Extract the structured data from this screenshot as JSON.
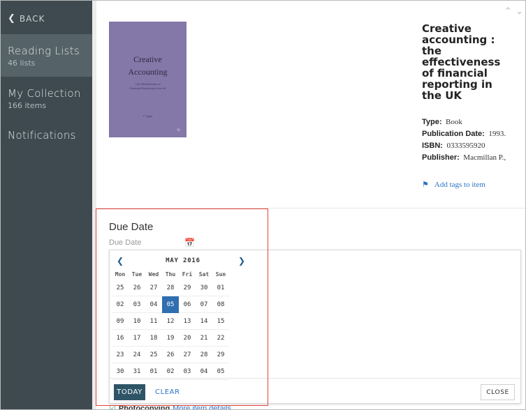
{
  "sidebar": {
    "back_label": "BACK",
    "items": [
      {
        "label": "Reading Lists",
        "sub": "46 lists"
      },
      {
        "label": "My Collection",
        "sub": "166 items"
      },
      {
        "label": "Notifications",
        "sub": ""
      }
    ]
  },
  "book": {
    "cover": {
      "title_line1": "Creative",
      "title_line2": "Accounting",
      "subtitle_line1": "The Effectiveness of",
      "subtitle_line2": "Financial Reporting in the UK",
      "author": "T Pijper"
    },
    "title": "Creative accounting : the effectiveness of financial reporting in the UK",
    "type_label": "Type:",
    "type_value": "Book",
    "date_label": "Publication Date:",
    "date_value": "1993.",
    "isbn_label": "ISBN:",
    "isbn_value": "0333595920",
    "publisher_label": "Publisher:",
    "publisher_value": "Macmillan P.,",
    "add_tags": "Add tags to item"
  },
  "due_date": {
    "title": "Due Date",
    "field_placeholder": "Due Date"
  },
  "calendar": {
    "month_label": "MAY 2016",
    "weekdays": [
      "Mon",
      "Tue",
      "Wed",
      "Thu",
      "Fri",
      "Sat",
      "Sun"
    ],
    "weeks": [
      [
        "25",
        "26",
        "27",
        "28",
        "29",
        "30",
        "01"
      ],
      [
        "02",
        "03",
        "04",
        "05",
        "06",
        "07",
        "08"
      ],
      [
        "09",
        "10",
        "11",
        "12",
        "13",
        "14",
        "15"
      ],
      [
        "16",
        "17",
        "18",
        "19",
        "20",
        "21",
        "22"
      ],
      [
        "23",
        "24",
        "25",
        "26",
        "27",
        "28",
        "29"
      ],
      [
        "30",
        "31",
        "01",
        "02",
        "03",
        "04",
        "05"
      ]
    ],
    "selected": "05",
    "today_label": "TODAY",
    "clear_label": "CLEAR",
    "close_label": "CLOSE"
  },
  "bottom": {
    "photocopying": "Photocopying",
    "more_details": "More item details"
  },
  "colors": {
    "sidebar_bg": "#3e4a50",
    "accent_blue": "#2b74c6",
    "selected_day": "#2f6fb0",
    "today_button": "#2e5566",
    "highlight_box": "#e0433a"
  }
}
